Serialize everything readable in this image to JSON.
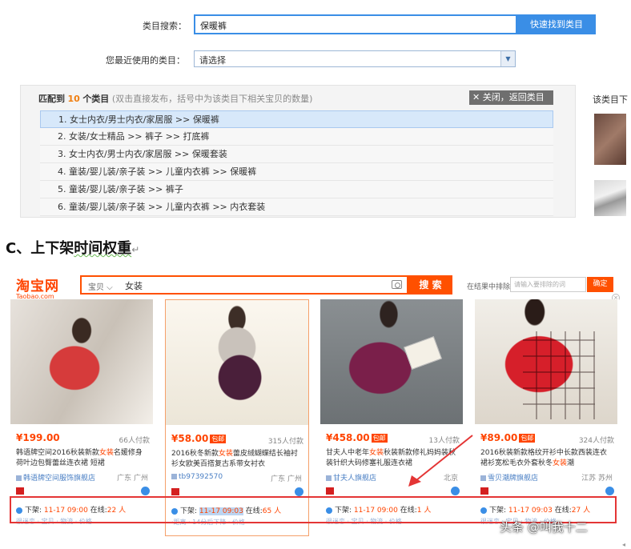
{
  "category_search": {
    "label": "类目搜索：",
    "input_value": "保暖裤",
    "button_label": "快速找到类目",
    "recent_label": "您最近使用的类目：",
    "recent_value": "请选择"
  },
  "match": {
    "prefix": "匹配到",
    "count": "10",
    "suffix": "个类目",
    "hint": "(双击直接发布，括号中为该类目下相关宝贝的数量)",
    "close_label": "关闭，返回类目",
    "side_title": "该类目下",
    "items": [
      "1.  女士内衣/男士内衣/家居服 >> 保暖裤",
      "2.  女装/女士精品 >> 裤子 >> 打底裤",
      "3.  女士内衣/男士内衣/家居服 >> 保暖套装",
      "4.  童装/婴儿装/亲子装 >> 儿童内衣裤 >> 保暖裤",
      "5.  童装/婴儿装/亲子装 >> 裤子",
      "6.  童装/婴儿装/亲子装 >> 儿童内衣裤 >> 内衣套装"
    ]
  },
  "section": {
    "prefix": "C、上下架",
    "underlined": "时间权重",
    "mark": "↵"
  },
  "taobao": {
    "logo": "淘宝网",
    "logo_en": "Taobao.com",
    "scope": "宝贝 ⌵",
    "query": "女装",
    "search_btn": "搜 索",
    "in_result_label": "在结果中排除",
    "in_result_placeholder": "请输入要排除的词",
    "confirm": "确定",
    "close": "×"
  },
  "products": [
    {
      "price": "¥199.00",
      "pay_tag": "",
      "sold": "66人付款",
      "title_pre": "韩语牌空间2016秋装新款",
      "title_kw": "女装",
      "title_post": "名媛修身荷叶边包臀蕾丝连衣裙 短裙",
      "shop": "韩语牌空间服饰旗舰店",
      "loc": "广东 广州",
      "shelf_label": "下架:",
      "shelf_time": "11-17 09:00",
      "online_label": "在线:",
      "online": "22 人",
      "subline": "很迷恋 · 宝贝 · 物流 · 价格"
    },
    {
      "price": "¥58.00",
      "pay_tag": "包邮",
      "sold": "315人付款",
      "title_pre": "2016秋冬新款",
      "title_kw": "女装",
      "title_post": "蕾皮绒蝴蝶结长袖衬衫女欧美百搭复古系带女衬衣",
      "shop": "tb97392570",
      "loc": "广东 广州",
      "shelf_label": "下架:",
      "shelf_time": "11-17 09:03",
      "online_label": "在线:",
      "online": "65 人",
      "subline": "·距离 · 14分后下降 · 价格"
    },
    {
      "price": "¥458.00",
      "pay_tag": "包邮",
      "sold": "13人付款",
      "title_pre": "甘夫人中老年",
      "title_kw": "女装",
      "title_post": "秋装新款修礼妈妈装秋装针织大码修塞礼服连衣裙",
      "shop": "甘夫人旗舰店",
      "loc": "北京",
      "shelf_label": "下架:",
      "shelf_time": "11-17 09:00",
      "online_label": "在线:",
      "online": "1 人",
      "subline": "很迷恋 · 宝贝 · 物流 · 价格"
    },
    {
      "price": "¥89.00",
      "pay_tag": "包邮",
      "sold": "324人付款",
      "title_pre": "2016秋装新款格纹开衫中长款西装连衣裙衫宽松毛衣外套秋冬",
      "title_kw": "女装",
      "title_post": "潮",
      "shop": "雪贝潮牌旗舰店",
      "loc": "江苏 苏州",
      "shelf_label": "下架:",
      "shelf_time": "11-17 09:03",
      "online_label": "在线:",
      "online": "27 人",
      "subline": "很迷恋 · 宝贝 · 物流 · 价格"
    }
  ],
  "watermark": "头条 @叫我十二",
  "edge_mark": "◂",
  "colors": {
    "taobao_orange": "#ff5000",
    "price_red": "#ff4400",
    "search_blue": "#3a8ee6",
    "highlight_box": "#e43535"
  }
}
